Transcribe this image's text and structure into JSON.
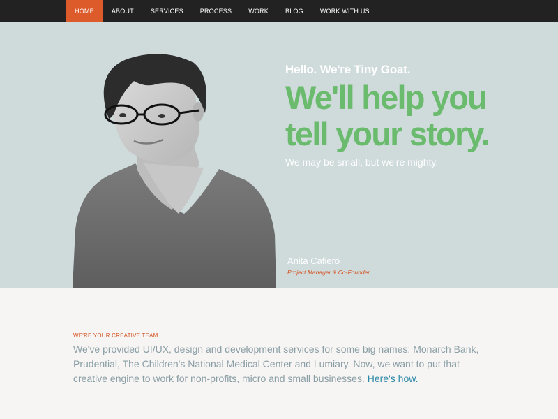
{
  "nav": {
    "items": [
      {
        "label": "HOME",
        "active": true
      },
      {
        "label": "ABOUT"
      },
      {
        "label": "SERVICES"
      },
      {
        "label": "PROCESS"
      },
      {
        "label": "WORK"
      },
      {
        "label": "BLOG"
      },
      {
        "label": "WORK WITH US"
      }
    ]
  },
  "hero": {
    "hello": "Hello. We're Tiny Goat.",
    "headline_line1": "We'll help you",
    "headline_line2": "tell your story.",
    "subline": "We may be small, but we're mighty.",
    "person_name": "Anita Cafiero",
    "person_role": "Project Manager & Co-Founder"
  },
  "intro": {
    "label": "WE'RE YOUR CREATIVE TEAM",
    "text": "We've provided UI/UX, design and development services for some big names: Monarch Bank, Prudential, The Children's National Medical Center and Lumiary. Now, we want to put that creative engine to work for non-profits, micro and small businesses. ",
    "link_label": "Here's how."
  },
  "colors": {
    "nav_bg": "#222222",
    "accent_orange": "#dd5a2a",
    "hero_bg": "#cfdadb",
    "headline_green": "#6bbb6e",
    "body_text": "#8a9ea5",
    "link_blue": "#2a87a8"
  }
}
